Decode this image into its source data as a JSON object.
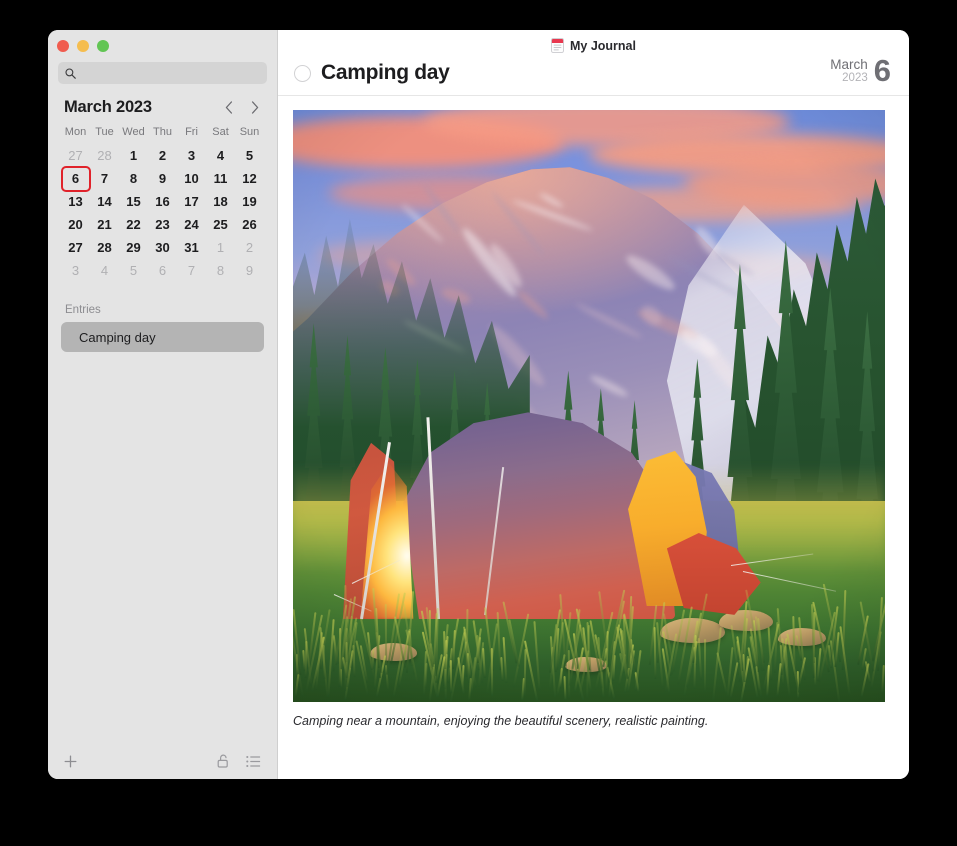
{
  "window": {
    "traffic_lights": [
      {
        "name": "close",
        "color": "#f05c4f"
      },
      {
        "name": "minimize",
        "color": "#f5bd4f"
      },
      {
        "name": "maximize",
        "color": "#62c554"
      }
    ]
  },
  "sidebar": {
    "search": {
      "value": "",
      "placeholder": "",
      "icon": "search-icon"
    },
    "calendar": {
      "title": "March 2023",
      "prev_icon": "chevron-left-icon",
      "next_icon": "chevron-right-icon",
      "weekdays": [
        "Mon",
        "Tue",
        "Wed",
        "Thu",
        "Fri",
        "Sat",
        "Sun"
      ],
      "selected_day": 6,
      "selection_color": "#e0222a",
      "weeks": [
        [
          {
            "d": "27",
            "muted": true
          },
          {
            "d": "28",
            "muted": true
          },
          {
            "d": "1"
          },
          {
            "d": "2"
          },
          {
            "d": "3"
          },
          {
            "d": "4"
          },
          {
            "d": "5"
          }
        ],
        [
          {
            "d": "6",
            "sel": true
          },
          {
            "d": "7"
          },
          {
            "d": "8"
          },
          {
            "d": "9"
          },
          {
            "d": "10"
          },
          {
            "d": "11"
          },
          {
            "d": "12"
          }
        ],
        [
          {
            "d": "13"
          },
          {
            "d": "14"
          },
          {
            "d": "15"
          },
          {
            "d": "16"
          },
          {
            "d": "17"
          },
          {
            "d": "18"
          },
          {
            "d": "19"
          }
        ],
        [
          {
            "d": "20"
          },
          {
            "d": "21"
          },
          {
            "d": "22"
          },
          {
            "d": "23"
          },
          {
            "d": "24"
          },
          {
            "d": "25"
          },
          {
            "d": "26"
          }
        ],
        [
          {
            "d": "27"
          },
          {
            "d": "28"
          },
          {
            "d": "29"
          },
          {
            "d": "30"
          },
          {
            "d": "31"
          },
          {
            "d": "1",
            "muted": true
          },
          {
            "d": "2",
            "muted": true
          }
        ],
        [
          {
            "d": "3",
            "muted": true
          },
          {
            "d": "4",
            "muted": true
          },
          {
            "d": "5",
            "muted": true
          },
          {
            "d": "6",
            "muted": true
          },
          {
            "d": "7",
            "muted": true
          },
          {
            "d": "8",
            "muted": true
          },
          {
            "d": "9",
            "muted": true
          }
        ]
      ]
    },
    "entries_label": "Entries",
    "entries": [
      {
        "title": "Camping day",
        "active": true
      }
    ],
    "toolbar": {
      "add_label": "+",
      "add_icon": "plus-icon",
      "lock_icon": "unlock-icon",
      "list_icon": "list-icon"
    }
  },
  "content": {
    "app_title": "My Journal",
    "app_icon": "journal-document-icon",
    "entry": {
      "completed": false,
      "checkbox_icon": "circle-unchecked-icon",
      "title": "Camping day",
      "caption": "Camping near a mountain, enjoying the beautiful scenery, realistic painting."
    },
    "date": {
      "month": "March",
      "year": "2023",
      "day": "6"
    },
    "image": {
      "alt": "Painting of a glowing tent camped in a grassy meadow before a large mountain at sunset"
    }
  }
}
